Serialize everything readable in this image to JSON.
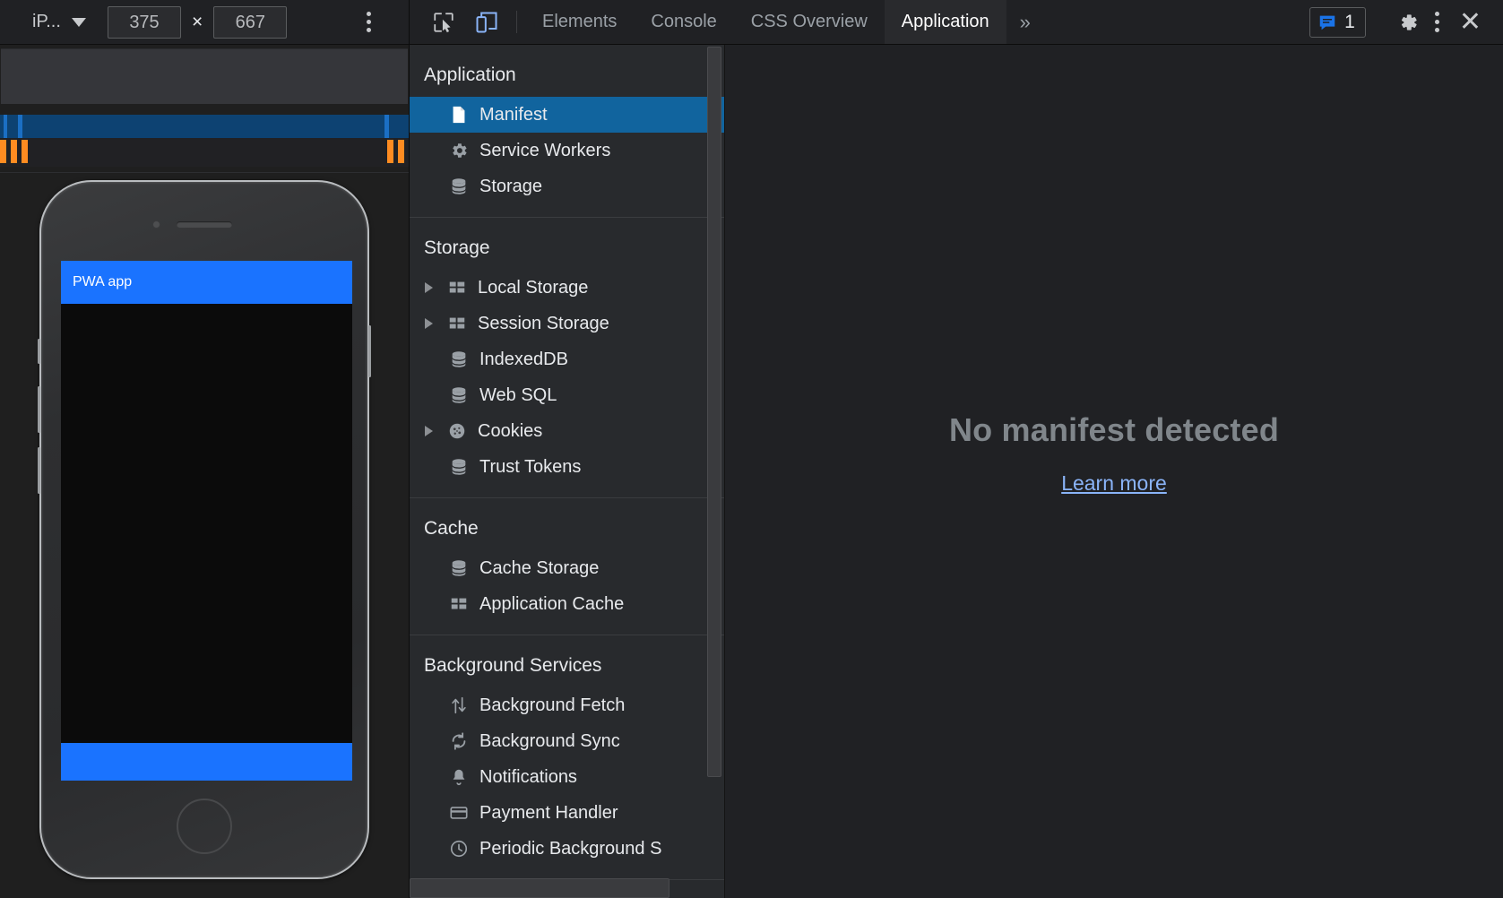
{
  "device_toolbar": {
    "device_name": "iP...",
    "width_value": "375",
    "height_value": "667",
    "multiply_symbol": "×",
    "menu_icon": "kebab-menu-icon",
    "caret_icon": "chevron-down-icon"
  },
  "phone_preview": {
    "app_header_title": "PWA app",
    "header_color": "#1a73ff",
    "footer_color": "#1a73ff",
    "screen_background": "#0b0b0b"
  },
  "devtools": {
    "toolbar": {
      "inspect_icon": "inspect-cursor-icon",
      "device_toggle_icon": "device-toolbar-icon",
      "tabs": [
        {
          "label": "Elements",
          "active": false
        },
        {
          "label": "Console",
          "active": false
        },
        {
          "label": "CSS Overview",
          "active": false
        },
        {
          "label": "Application",
          "active": true
        }
      ],
      "more_tabs_label": "»",
      "message_count": "1",
      "message_icon": "message-bubble-icon",
      "settings_icon": "gear-icon",
      "more_options_icon": "kebab-menu-icon",
      "close_icon": "close-icon",
      "accent_color": "#1a73e8"
    },
    "sidebar": {
      "selection_color": "#11649e",
      "sections": [
        {
          "title": "Application",
          "items": [
            {
              "label": "Manifest",
              "icon": "document-icon",
              "expandable": false,
              "selected": true
            },
            {
              "label": "Service Workers",
              "icon": "gear-icon",
              "expandable": false,
              "selected": false
            },
            {
              "label": "Storage",
              "icon": "database-icon",
              "expandable": false,
              "selected": false
            }
          ]
        },
        {
          "title": "Storage",
          "items": [
            {
              "label": "Local Storage",
              "icon": "table-icon",
              "expandable": true,
              "selected": false
            },
            {
              "label": "Session Storage",
              "icon": "table-icon",
              "expandable": true,
              "selected": false
            },
            {
              "label": "IndexedDB",
              "icon": "database-icon",
              "expandable": false,
              "selected": false
            },
            {
              "label": "Web SQL",
              "icon": "database-icon",
              "expandable": false,
              "selected": false
            },
            {
              "label": "Cookies",
              "icon": "cookie-icon",
              "expandable": true,
              "selected": false
            },
            {
              "label": "Trust Tokens",
              "icon": "database-icon",
              "expandable": false,
              "selected": false
            }
          ]
        },
        {
          "title": "Cache",
          "items": [
            {
              "label": "Cache Storage",
              "icon": "database-icon",
              "expandable": false,
              "selected": false
            },
            {
              "label": "Application Cache",
              "icon": "table-icon",
              "expandable": false,
              "selected": false
            }
          ]
        },
        {
          "title": "Background Services",
          "items": [
            {
              "label": "Background Fetch",
              "icon": "arrows-up-down-icon",
              "expandable": false,
              "selected": false
            },
            {
              "label": "Background Sync",
              "icon": "sync-icon",
              "expandable": false,
              "selected": false
            },
            {
              "label": "Notifications",
              "icon": "bell-icon",
              "expandable": false,
              "selected": false
            },
            {
              "label": "Payment Handler",
              "icon": "credit-card-icon",
              "expandable": false,
              "selected": false
            },
            {
              "label": "Periodic Background S",
              "icon": "clock-icon",
              "expandable": false,
              "selected": false
            }
          ]
        }
      ]
    },
    "main_panel": {
      "empty_title": "No manifest detected",
      "empty_link": "Learn more",
      "link_color": "#8ab4f8"
    }
  }
}
